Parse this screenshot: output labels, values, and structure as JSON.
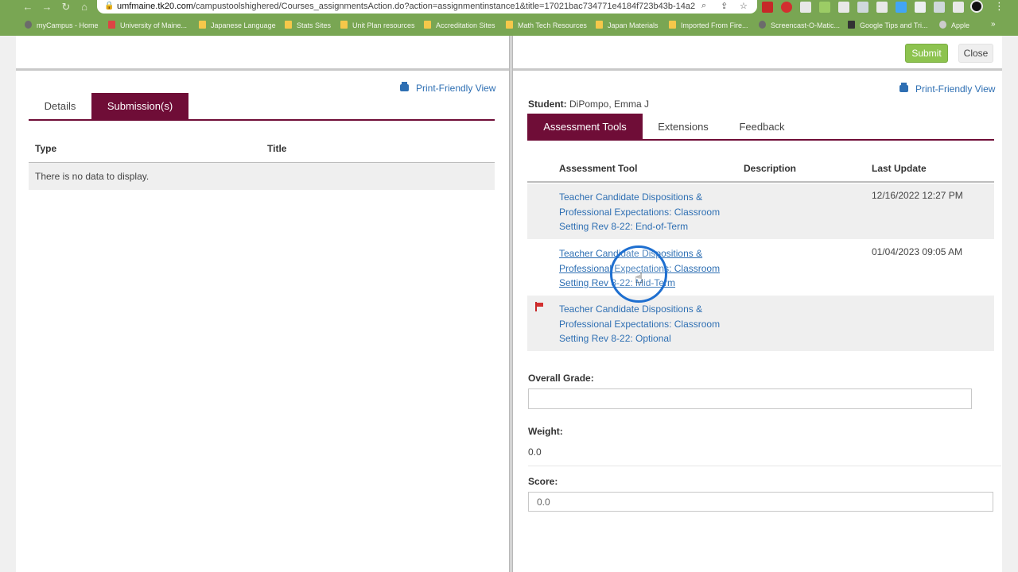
{
  "browser": {
    "url_host": "umfmaine.tk20.com",
    "url_path": "/campustoolshighered/Courses_assignmentsAction.do?action=assignmentinstance1&title=17021bac734771e4184f723b43b-14a2",
    "bookmarks": [
      {
        "label": "myCampus - Home",
        "icon": "globe-icon"
      },
      {
        "label": "University of Maine...",
        "icon": "gmail-icon"
      },
      {
        "label": "Japanese Language",
        "icon": "folder-icon"
      },
      {
        "label": "Stats Sites",
        "icon": "folder-icon"
      },
      {
        "label": "Unit Plan resources",
        "icon": "folder-icon"
      },
      {
        "label": "Accreditation Sites",
        "icon": "folder-icon"
      },
      {
        "label": "Math Tech Resources",
        "icon": "folder-icon"
      },
      {
        "label": "Japan Materials",
        "icon": "folder-icon"
      },
      {
        "label": "Imported From Fire...",
        "icon": "folder-icon"
      },
      {
        "label": "Screencast-O-Matic...",
        "icon": "globe-icon"
      },
      {
        "label": "Google Tips and Tri...",
        "icon": "g-icon"
      },
      {
        "label": "Apple",
        "icon": "apple-icon"
      }
    ],
    "bookmarks_more": "»"
  },
  "header": {
    "submit_label": "Submit",
    "close_label": "Close"
  },
  "left": {
    "print_label": "Print-Friendly View",
    "tabs": [
      {
        "label": "Details",
        "active": false
      },
      {
        "label": "Submission(s)",
        "active": true
      }
    ],
    "columns": [
      "Type",
      "Title"
    ],
    "empty_message": "There is no data to display."
  },
  "right": {
    "print_label": "Print-Friendly View",
    "student_label": "Student:",
    "student_name": "DiPompo, Emma J",
    "tabs": [
      {
        "label": "Assessment Tools",
        "active": true
      },
      {
        "label": "Extensions",
        "active": false
      },
      {
        "label": "Feedback",
        "active": false
      }
    ],
    "columns": [
      "Assessment Tool",
      "Description",
      "Last Update"
    ],
    "rows": [
      {
        "tool": "Teacher Candidate Dispositions & Professional Expectations: Classroom Setting Rev 8-22: End-of-Term",
        "description": "",
        "last_update": "12/16/2022 12:27 PM",
        "flagged": false
      },
      {
        "tool": "Teacher Candidate Dispositions & Professional Expectations: Classroom Setting Rev 8-22: Mid-Term",
        "description": "",
        "last_update": "01/04/2023 09:05 AM",
        "flagged": false
      },
      {
        "tool": "Teacher Candidate Dispositions & Professional Expectations: Classroom Setting Rev 8-22: Optional",
        "description": "",
        "last_update": "",
        "flagged": true
      }
    ],
    "overall_grade_label": "Overall Grade:",
    "overall_grade_value": "",
    "weight_label": "Weight:",
    "weight_value": "0.0",
    "score_label": "Score:",
    "score_value": "0.0"
  },
  "colors": {
    "chrome": "#79a653",
    "accent": "#6f0d37",
    "link": "#2e6fb3",
    "submit": "#8dc34f"
  }
}
